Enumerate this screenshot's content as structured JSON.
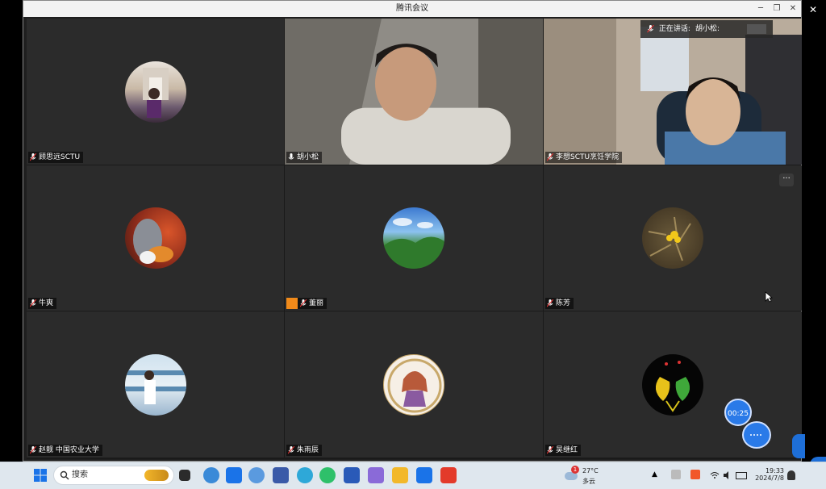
{
  "window": {
    "title": "腾讯会议",
    "minimize": "─",
    "restore": "❐",
    "close": "✕"
  },
  "outer_close": "✕",
  "speaking": {
    "label": "正在讲话:",
    "name": "胡小松:"
  },
  "tiles": [
    {
      "name": "顾思远SCTU"
    },
    {
      "name": "胡小松"
    },
    {
      "name": "李想SCTU烹饪学院"
    },
    {
      "name": "牛爽"
    },
    {
      "name": "董丽"
    },
    {
      "name": "陈芳"
    },
    {
      "name": "赵靓 中国农业大学"
    },
    {
      "name": "朱雨辰"
    },
    {
      "name": "吴继红"
    }
  ],
  "more_button": "···",
  "timer": "00:25",
  "taskbar": {
    "search_placeholder": "搜索",
    "weather_temp": "27°C",
    "weather_desc": "多云",
    "weather_badge": "1",
    "time": "19:33",
    "date": "2024/7/8"
  },
  "colors": {
    "active_border": "#2ec06a",
    "accent": "#2a7ae8"
  }
}
